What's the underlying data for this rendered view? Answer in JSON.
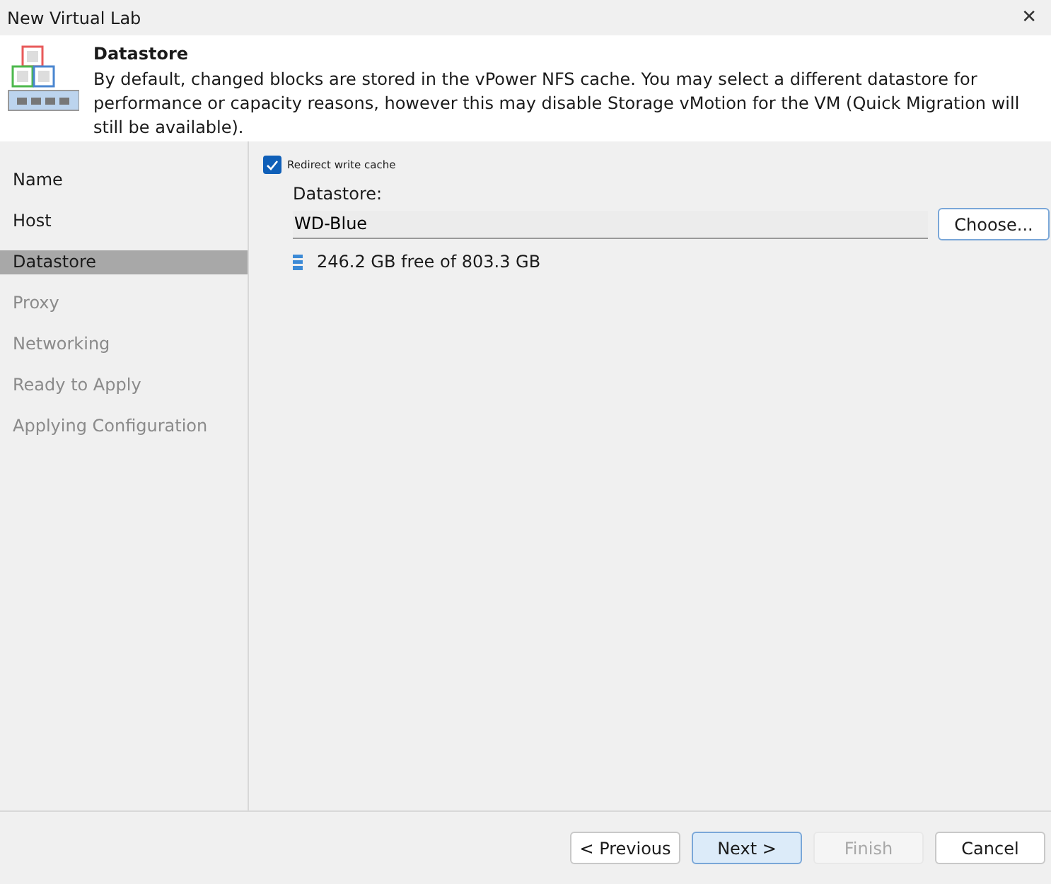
{
  "window": {
    "title": "New Virtual Lab",
    "close": "✕"
  },
  "header": {
    "title": "Datastore",
    "description": "By default, changed blocks are stored in the vPower NFS cache. You may select a different datastore for performance or capacity reasons, however this may disable Storage vMotion for the VM (Quick Migration will still be available)."
  },
  "steps": [
    {
      "label": "Name",
      "selected": false,
      "disabled": false
    },
    {
      "label": "Host",
      "selected": false,
      "disabled": false
    },
    {
      "label": "Datastore",
      "selected": true,
      "disabled": false
    },
    {
      "label": "Proxy",
      "selected": false,
      "disabled": true
    },
    {
      "label": "Networking",
      "selected": false,
      "disabled": true
    },
    {
      "label": "Ready to Apply",
      "selected": false,
      "disabled": true
    },
    {
      "label": "Applying Configuration",
      "selected": false,
      "disabled": true
    }
  ],
  "redirect": {
    "label": "Redirect write cache",
    "checked": true
  },
  "datastore": {
    "label": "Datastore:",
    "value": "WD-Blue",
    "choose": "Choose...",
    "free": "246.2 GB free of 803.3 GB"
  },
  "buttons": [
    {
      "label": "< Previous",
      "default": false,
      "disabled": false
    },
    {
      "label": "Next >",
      "default": true,
      "disabled": false
    },
    {
      "label": "Finish",
      "default": false,
      "disabled": true
    },
    {
      "label": "Cancel",
      "default": false,
      "disabled": false
    }
  ]
}
